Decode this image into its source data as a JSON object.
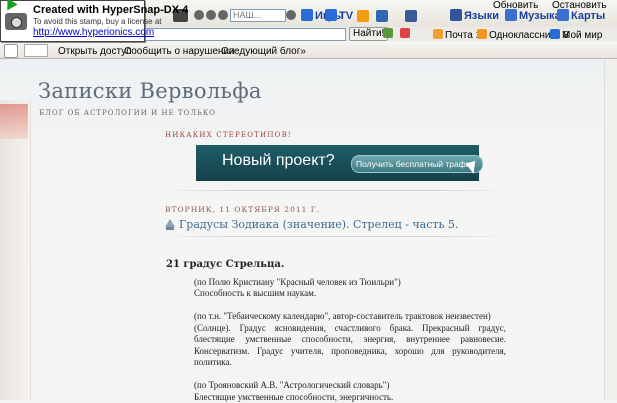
{
  "stamp": {
    "title": "Created with HyperSnap-DX 4",
    "note": "To avoid this stamp, buy a license at",
    "url": "http://www.hyperionics.com"
  },
  "browser": {
    "top_right": {
      "refresh": "Обновить",
      "stop": "Остановить"
    },
    "search_placeholder": "НАШ...",
    "go_label": "Найти!",
    "toolbar_items": [
      "Игры",
      "TV",
      "Языки",
      "Музыка",
      "Карты"
    ],
    "links": [
      "Почта 1",
      "Одноклассники 8",
      "Мой мир"
    ],
    "blog_nav": [
      "Открыть доступ",
      "Сообщить о нарушении",
      "Следующий блог»"
    ]
  },
  "blog": {
    "title": "Записки Вервольфа",
    "description": "БЛОГ ОБ АСТРОЛОГИИ И НЕ ТОЛЬКО",
    "widget_title": "НИКАКИХ СТЕРЕОТИПОВ!",
    "banner_text": "Новый проект?",
    "banner_button": "Получить бесплатный трафик"
  },
  "post": {
    "date": "ВТОРНИК, 11 ОКТЯБРЯ 2011 Г.",
    "title": "Градусы Зодиака (значение). Стрелец - часть 5.",
    "heading": "21 градус Стрельца.",
    "lines": {
      "l1": "(по Полю Кристиану \"Красный человек из Тюильри\")",
      "l2": "Способность к высшим наукам.",
      "l3": "(по т.н. \"Тебаическому календарю\", автор-составитель трактовок неизвестен)",
      "l4": "(Солнце). Градус ясновидения, счастливого брака. Прекрасный градус, блестящие умственные способности, энергия, внутреннее равновесие. Консерватизм. Градус учителя, проповедника, хорошо для руководителя, политика.",
      "l5": "(по Трояновский А.В. \"Астрологический словарь\")",
      "l6": "Блестящие умственные способности, энергичность."
    }
  },
  "colors": {
    "title": "#5d6c78",
    "post_title": "#3f6b92",
    "banner": "#1f5d68"
  }
}
